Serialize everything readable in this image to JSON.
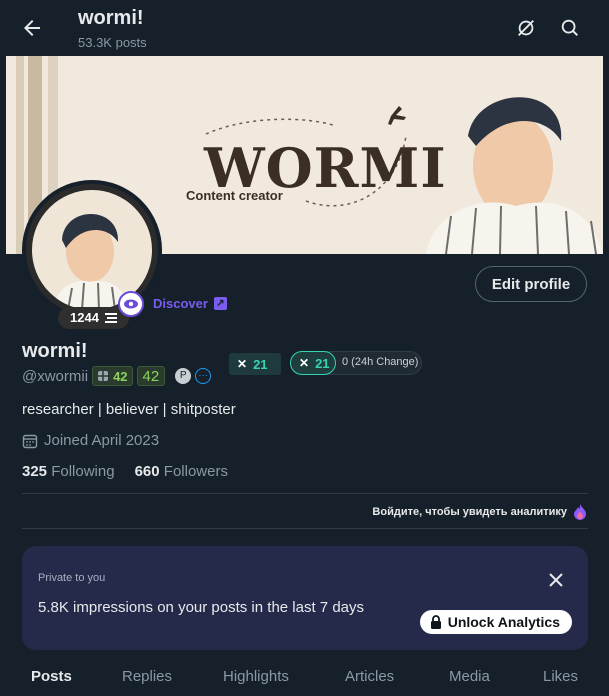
{
  "header": {
    "title": "wormi!",
    "post_count": "53.3K posts",
    "icons": [
      "back-arrow-icon",
      "no-signal-icon",
      "search-icon"
    ]
  },
  "banner": {
    "logo_text": "WORMI",
    "subtitle": "Content creator",
    "colors": {
      "background": "#f1e9dd",
      "ink": "#3b2e27"
    }
  },
  "profile": {
    "name": "wormi!",
    "handle": "@xwormii",
    "badge_count": "1244",
    "discover_label": "Discover",
    "edit_label": "Edit profile",
    "chip_score": "42",
    "chip_score2": "42",
    "x_score1": "21",
    "x_score2": "21",
    "change_label": "0 (24h Change)",
    "bio": "researcher | believer | shitposter",
    "joined": "Joined April 2023",
    "following_count": "325",
    "following_label": "Following",
    "followers_count": "660",
    "followers_label": "Followers"
  },
  "analytics_link": "Войдите, чтобы увидеть аналитику",
  "card": {
    "private_label": "Private to you",
    "message": "5.8K impressions on your posts in the last 7 days",
    "button_label": "Unlock Analytics"
  },
  "tabs": [
    {
      "label": "Posts"
    },
    {
      "label": "Replies"
    },
    {
      "label": "Highlights"
    },
    {
      "label": "Articles"
    },
    {
      "label": "Media"
    },
    {
      "label": "Likes"
    }
  ],
  "colors": {
    "bg": "#15202b",
    "accent_purple": "#7b5cf0",
    "accent_teal": "#35d3b3",
    "card_bg": "#252a4a"
  }
}
